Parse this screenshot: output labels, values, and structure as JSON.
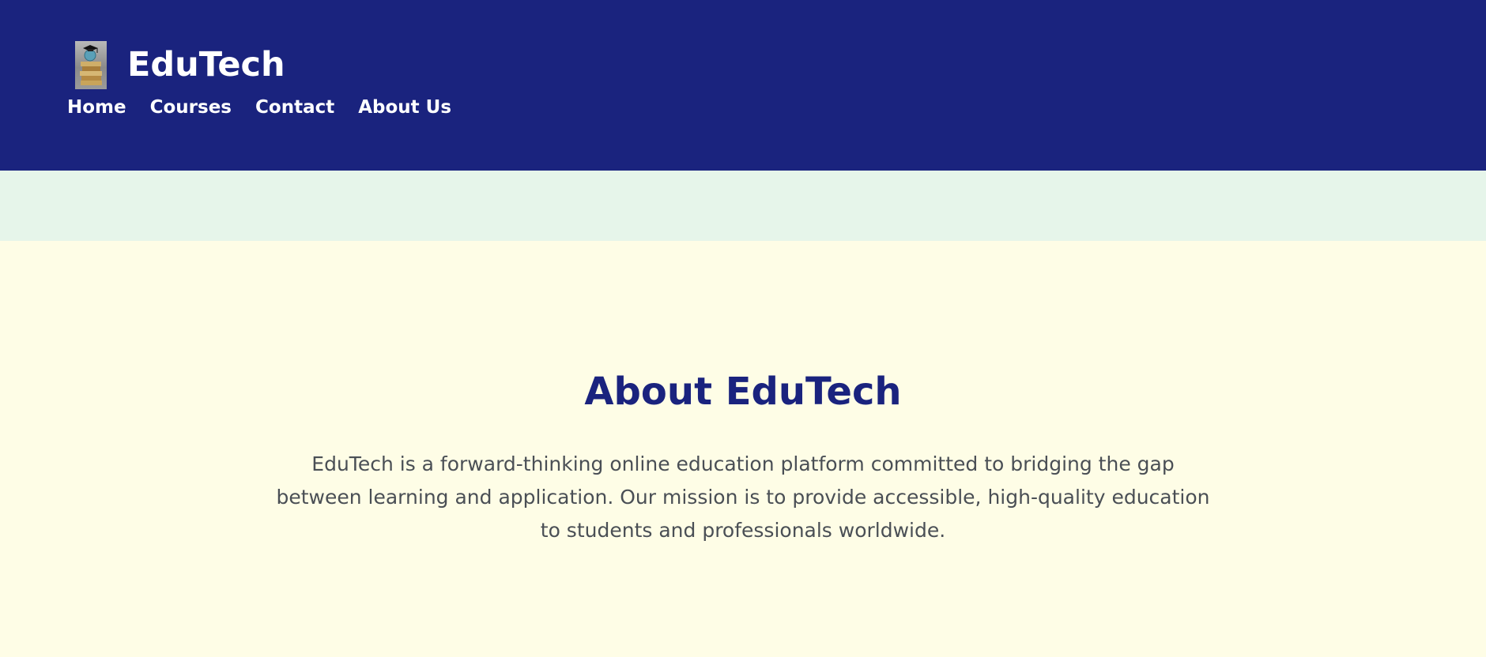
{
  "header": {
    "brand": "EduTech",
    "logo_icon": "books-graduation-cap-icon",
    "nav": [
      {
        "label": "Home"
      },
      {
        "label": "Courses"
      },
      {
        "label": "Contact"
      },
      {
        "label": "About Us"
      }
    ]
  },
  "about": {
    "title": "About EduTech",
    "text": "EduTech is a forward-thinking online education platform committed to bridging the gap between learning and application. Our mission is to provide accessible, high-quality education to students and professionals worldwide."
  },
  "colors": {
    "header_bg": "#1a237e",
    "band_bg": "#e6f5ea",
    "main_bg": "#fefde6",
    "title": "#1a237e",
    "body_text": "#4a4f55"
  }
}
